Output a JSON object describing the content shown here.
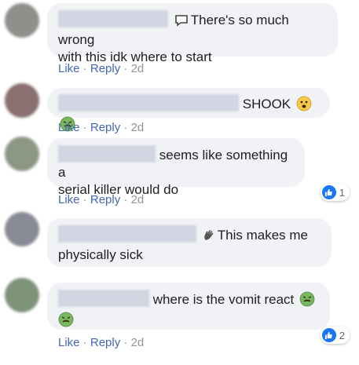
{
  "comments": [
    {
      "lead_icon": "chat-bubble-icon",
      "text": "There's so much wrong with this idk where to start",
      "line1": "There's so much wrong",
      "line2": "with this idk where to start",
      "actions": {
        "like": "Like",
        "reply": "Reply",
        "sep": "·",
        "time": "2d"
      },
      "avatar_color": "#8f8f8c"
    },
    {
      "text": "SHOOK",
      "emojis": [
        "woozy-face-icon",
        "nauseated-face-icon"
      ],
      "actions": {
        "like": "Like",
        "reply": "Reply",
        "sep": "·",
        "time": "2d"
      },
      "avatar_color": "#8a7070"
    },
    {
      "line1": "seems like something a",
      "line2": "serial killer would do",
      "actions": {
        "like": "Like",
        "reply": "Reply",
        "sep": "·",
        "time": "2d"
      },
      "reaction": {
        "icon": "thumbs-up-icon",
        "count": "1"
      },
      "avatar_color": "#8c9786"
    },
    {
      "lead_icon": "waving-hand-icon",
      "line1": "This makes me",
      "line2": "physically sick",
      "avatar_color": "#888a96"
    },
    {
      "line1": "where is the vomit react",
      "emojis": [
        "nauseated-face-icon",
        "nauseated-face-icon"
      ],
      "actions": {
        "like": "Like",
        "reply": "Reply",
        "sep": "·",
        "time": "2d"
      },
      "reaction": {
        "icon": "thumbs-up-icon",
        "count": "2"
      },
      "avatar_color": "#7e9478"
    }
  ],
  "colors": {
    "bubble_bg": "#f0f2f5",
    "link": "#4267b2",
    "meta_gray": "#90949c",
    "like_blue": "#1877f2",
    "nauseated_green": "#7bb661"
  }
}
